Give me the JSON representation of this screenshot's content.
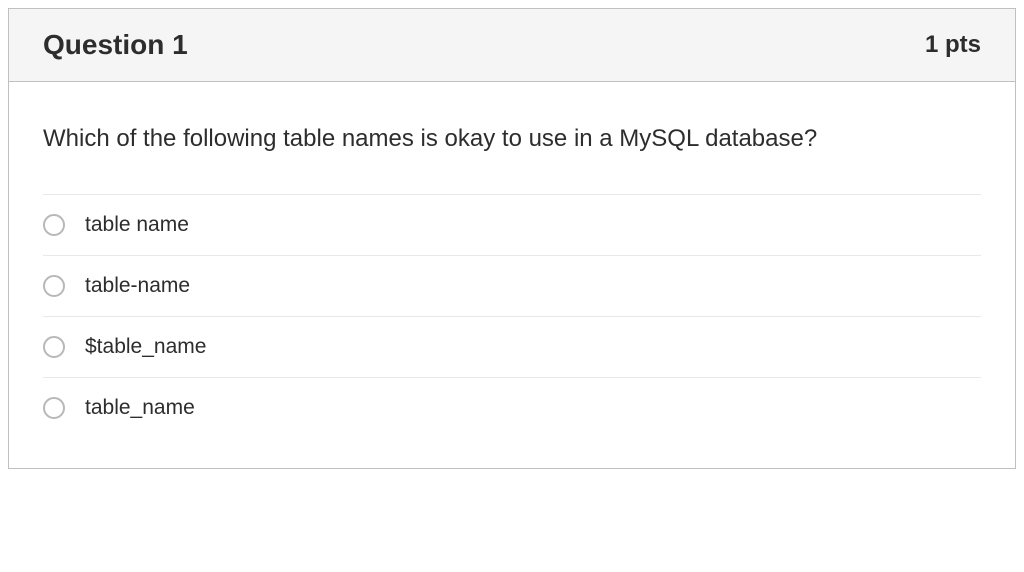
{
  "header": {
    "title": "Question 1",
    "points": "1 pts"
  },
  "question": {
    "text": "Which of the following table names is okay to use in a MySQL database?"
  },
  "options": [
    {
      "label": "table name"
    },
    {
      "label": "table-name"
    },
    {
      "label": "$table_name"
    },
    {
      "label": "table_name"
    }
  ]
}
